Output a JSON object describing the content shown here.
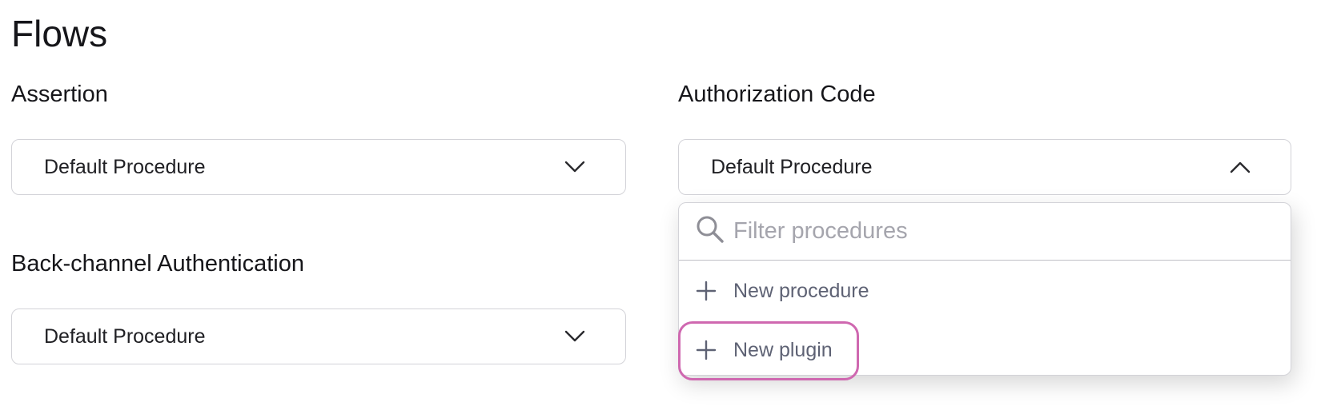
{
  "page": {
    "title": "Flows"
  },
  "fields": {
    "assertion": {
      "label": "Assertion",
      "value": "Default Procedure"
    },
    "back_channel": {
      "label": "Back-channel Authentication",
      "value": "Default Procedure"
    },
    "authorization_code": {
      "label": "Authorization Code",
      "value": "Default Procedure"
    }
  },
  "dropdown": {
    "filter_placeholder": "Filter procedures",
    "items": [
      {
        "label": "New procedure",
        "icon": "plus-icon"
      },
      {
        "label": "New plugin",
        "icon": "plus-icon",
        "highlighted": true
      }
    ]
  },
  "colors": {
    "highlight_ring": "#cf68b0",
    "menu_text": "#5e6274",
    "border": "#d3d3d8"
  }
}
